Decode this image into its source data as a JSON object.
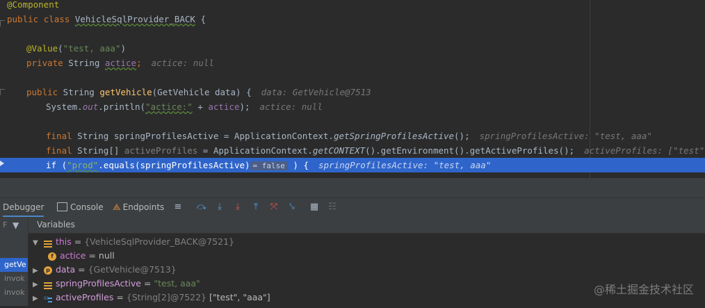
{
  "editor": {
    "lines": {
      "l1_annotation": "@Component",
      "l2_public": "public",
      "l2_class": "class",
      "l2_name": "VehicleSqlProvider_BACK",
      "l2_brace": " {",
      "l4_value": "@Value",
      "l4_open": "(",
      "l4_str": "\"test, aaa\"",
      "l4_close": ")",
      "l5_private": "private",
      "l5_type": " String ",
      "l5_field": "actice",
      "l5_semi": ";",
      "l5_hint": "actice: null",
      "l7_public": "public",
      "l7_sig1": " String ",
      "l7_method": "getVehicle",
      "l7_sig2": "(GetVehicle data) {",
      "l7_hint": "data: GetVehicle@7513",
      "l8_sys": "System.",
      "l8_out": "out",
      "l8_println": ".println(",
      "l8_str": "\"actice:\"",
      "l8_plus": " + ",
      "l8_field": "actice",
      "l8_end": ");",
      "l8_hint": "actice: null",
      "l10_final": "final",
      "l10_decl": " String springProfilesActive = ApplicationContext.",
      "l10_call": "getSpringProfilesActive",
      "l10_end": "();",
      "l10_hint": "springProfilesActive: \"test, aaa\"",
      "l11_final": "final",
      "l11_decl": " String[] ",
      "l11_var": "activeProfiles",
      "l11_mid": " = ApplicationContext.",
      "l11_call": "getCONTEXT",
      "l11_end": "().getEnvironment().getActiveProfiles();",
      "l11_hint": "activeProfiles: [\"test\", \"aaa\"]",
      "l12_if": "if",
      "l12_open": " (",
      "l12_str": "\"prod\"",
      "l12_mid": ".equals(springProfilesActive)",
      "l12_inlay": "= false",
      "l12_end": " ) {",
      "l12_hint": "springProfilesActive: \"test, aaa\""
    }
  },
  "debugger": {
    "tabs": {
      "debugger": "Debugger",
      "console": "Console",
      "endpoints": "Endpoints"
    },
    "variables_header": "Variables",
    "frames": {
      "filter_label": "F",
      "items": [
        "getVe",
        "invok",
        "invok"
      ]
    },
    "variables": [
      {
        "name": "this",
        "eq": " = ",
        "value": "{VehicleSqlProvider_BACK@7521}"
      },
      {
        "name": "actice",
        "eq": " = ",
        "value": "null"
      },
      {
        "name": "data",
        "eq": " = ",
        "value": "{GetVehicle@7513}"
      },
      {
        "name": "springProfilesActive",
        "eq": " = ",
        "value": "\"test, aaa\""
      },
      {
        "name": "activeProfiles",
        "eq": " = ",
        "value": "{String[2]@7522}",
        "extra": " [\"test\", \"aaa\"]"
      }
    ]
  },
  "watermark": "@稀土掘金技术社区",
  "colors": {
    "execution_line": "#2f65ca",
    "keyword": "#cc7832",
    "string": "#6a8759",
    "field": "#9876aa",
    "method": "#ffc66d"
  }
}
